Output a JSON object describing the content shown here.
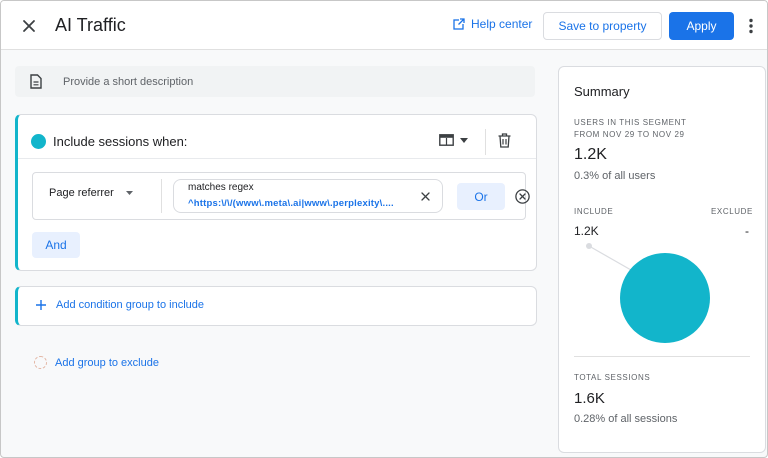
{
  "header": {
    "title": "AI Traffic",
    "help_label": "Help center",
    "save_label": "Save to property",
    "apply_label": "Apply"
  },
  "description": {
    "placeholder": "Provide a short description"
  },
  "include_group": {
    "title": "Include sessions when:",
    "accent_color": "#12b5cb",
    "condition": {
      "dimension": "Page referrer",
      "match_type": "matches regex",
      "value": "^https:\\/\\/(www\\.meta\\.ai|www\\.perplexity\\...."
    },
    "or_label": "Or",
    "and_label": "And"
  },
  "add_include_label": "Add condition group to include",
  "add_exclude_label": "Add group to exclude",
  "summary": {
    "title": "Summary",
    "users_label_line1": "USERS IN THIS SEGMENT",
    "users_label_line2": "FROM NOV 29 TO NOV 29",
    "users_value": "1.2K",
    "users_pct": "0.3% of all users",
    "include_label": "INCLUDE",
    "exclude_label": "EXCLUDE",
    "include_value": "1.2K",
    "exclude_value": "-",
    "sessions_label": "TOTAL SESSIONS",
    "sessions_value": "1.6K",
    "sessions_pct": "0.28% of all sessions",
    "pie_color": "#12b5cb"
  },
  "colors": {
    "primary": "#1a73e8",
    "accent": "#12b5cb"
  }
}
